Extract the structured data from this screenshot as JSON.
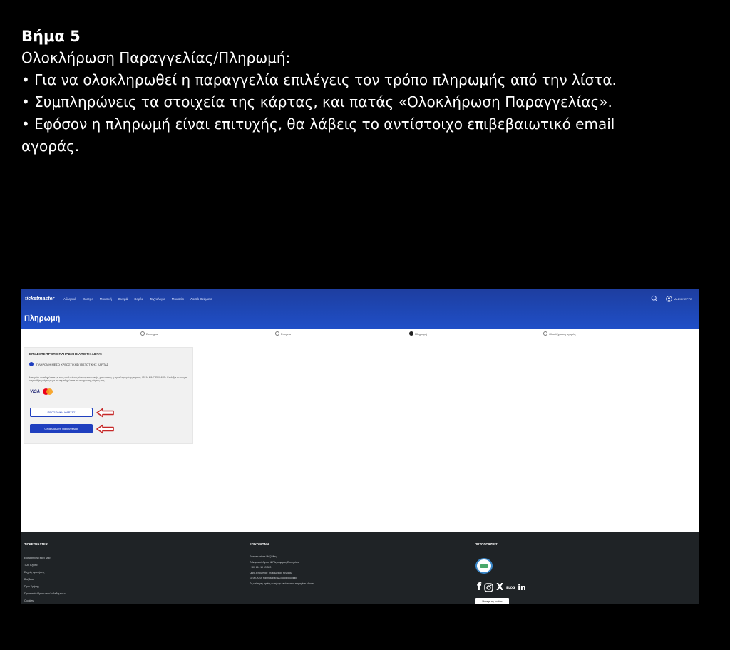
{
  "instructions": {
    "title": "Βήμα 5",
    "subtitle": "Ολοκλήρωση Παραγγελίας/Πληρωμή:",
    "bullets": [
      "• Για να ολοκληρωθεί η παραγγελία επιλέγεις τον τρόπο πληρωμής από την λίστα.",
      "• Συμπληρώνεις τα στοιχεία της κάρτας, και πατάς «Ολοκλήρωση Παραγγελίας».",
      "• Εφόσον η πληρωμή είναι επιτυχής, θα λάβεις το αντίστοιχο επιβεβαιωτικό email",
      "αγοράς."
    ]
  },
  "screenshot": {
    "header": {
      "logo": "ticketmaster",
      "nav": [
        "Αθλητικά",
        "Θέατρο",
        "Μουσική",
        "Σινεμά",
        "Χορός",
        "Τεχνολογία",
        "Μουσεία",
        "Λοιπά Θεάματα"
      ],
      "user_label": "ALEX NEPPE",
      "page_title": "Πληρωμή"
    },
    "steps": [
      "Εισιτήρια",
      "Στοιχεία",
      "Πληρωμή",
      "Ολοκλήρωση αγοράς"
    ],
    "payment": {
      "heading": "ΕΠΙΛΕΞΤΕ ΤΡΟΠΟ ΠΛΗΡΩΜΗΣ ΑΠΟ ΤΗ ΛΙΣΤΑ:",
      "option": "ΠΛΗΡΩΜΗ ΜΕΣΩ ΧΡΕΩΣΤΙΚΗΣ/ ΠΙΣΤΩΤΙΚΗΣ ΚΑΡΤΑΣ",
      "note": "Μπορείτε να πληρώσετε με τους ακόλουθους τύπους πιστωτικής, χρεωστικής ή προπληρωμένης κάρτας: VISA, MASTERCARD. Επιλέξτε το κουμπί «προσθήκη κάρτας» για να συμπληρώσετε τα στοιχεία της κάρτας σας.",
      "card_visa": "VISA",
      "add_card_label": "ΠΡΟΣΘΗΚΗ ΚΑΡΤΑΣ",
      "complete_label": "Ολοκλήρωση παραγγελίας"
    },
    "footer": {
      "col1_title": "TICKETMASTER",
      "col1_items": [
        "Εικηρρητάδα Μαζί Μας",
        "Τέλη Εξαιτά",
        "Συχνές ερωτήσεις",
        "Βοήθεια",
        "Όροι Χρήσης",
        "Προστασία Προσωπικών Δεδομένων",
        "Cookies"
      ],
      "col2_title": "ΕΠΙΚΟΙΝΩΝΙΑ",
      "col2_items": [
        "Επικοινωνήστε Μαζί Μας",
        "Τηλεφωνική Αγορά & Πληροφορίες Εισιτηρίων",
        "(+30) 211 19 19 320",
        "Ώρες λειτουργίας Τηλεφωνικού Κέντρου",
        "10:00-20:00 Καθημερινές & Σαββατοκύριακα",
        "Τις επίσημες αργίες το τηλεφωνικό κέντρο παραμένει κλειστό"
      ],
      "col3_title": "ΠΙΣΤΟΠΟΙΗΣΕΙΣ",
      "social": [
        "f",
        "X",
        "BLOG",
        "in"
      ],
      "cookie_button": "Manage my cookies"
    }
  },
  "colors": {
    "header_blue": "#1f4fc8",
    "primary_button": "#1f3fbf",
    "arrow_red": "#c62828",
    "footer_bg": "#1f2326"
  }
}
